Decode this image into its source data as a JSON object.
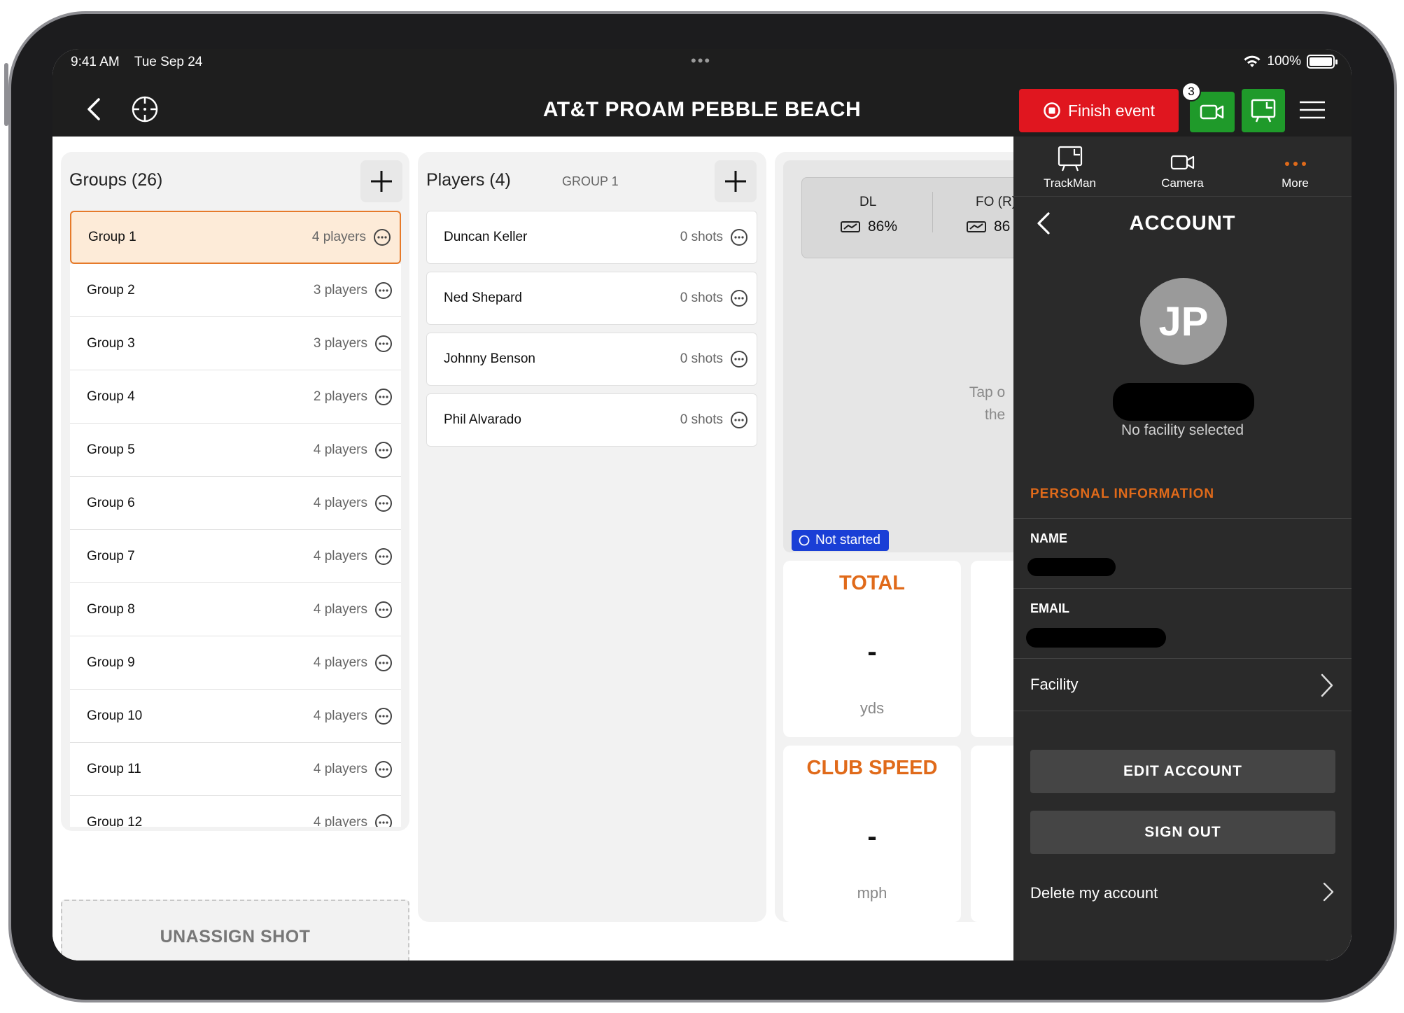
{
  "status": {
    "time": "9:41 AM",
    "date": "Tue Sep 24",
    "battery": "100%"
  },
  "nav": {
    "title": "AT&T PROAM PEBBLE BEACH",
    "finish_label": "Finish event",
    "camera_badge": "3"
  },
  "groups": {
    "title": "Groups (26)",
    "items": [
      {
        "name": "Group 1",
        "count": "4 players"
      },
      {
        "name": "Group 2",
        "count": "3 players"
      },
      {
        "name": "Group 3",
        "count": "3 players"
      },
      {
        "name": "Group 4",
        "count": "2 players"
      },
      {
        "name": "Group 5",
        "count": "4 players"
      },
      {
        "name": "Group 6",
        "count": "4 players"
      },
      {
        "name": "Group 7",
        "count": "4 players"
      },
      {
        "name": "Group 8",
        "count": "4 players"
      },
      {
        "name": "Group 9",
        "count": "4 players"
      },
      {
        "name": "Group 10",
        "count": "4 players"
      },
      {
        "name": "Group 11",
        "count": "4 players"
      },
      {
        "name": "Group 12",
        "count": "4 players"
      }
    ],
    "unassign_label": "UNASSIGN SHOT"
  },
  "players": {
    "title": "Players (4)",
    "group_label": "GROUP 1",
    "items": [
      {
        "name": "Duncan Keller",
        "shots": "0 shots"
      },
      {
        "name": "Ned Shepard",
        "shots": "0 shots"
      },
      {
        "name": "Johnny Benson",
        "shots": "0 shots"
      },
      {
        "name": "Phil Alvarado",
        "shots": "0 shots"
      }
    ]
  },
  "metrics": {
    "dl_label": "DL",
    "dl_value": "86%",
    "fo_label": "FO (R)",
    "fo_value": "86",
    "tap_line1": "Tap o",
    "tap_line2": "the",
    "status_badge": "Not started",
    "total_title": "TOTAL",
    "total_value": "-",
    "total_unit": "yds",
    "club_title": "CLUB SPEED",
    "club_value": "-",
    "club_unit": "mph"
  },
  "account": {
    "tabs": [
      {
        "label": "TrackMan"
      },
      {
        "label": "Camera"
      },
      {
        "label": "More"
      }
    ],
    "title": "ACCOUNT",
    "initials": "JP",
    "no_facility": "No facility selected",
    "section": "PERSONAL INFORMATION",
    "name_label": "NAME",
    "email_label": "EMAIL",
    "facility_label": "Facility",
    "edit_label": "EDIT ACCOUNT",
    "signout_label": "SIGN OUT",
    "delete_label": "Delete my account"
  },
  "colors": {
    "accent": "#e06a1a",
    "danger": "#e0161f",
    "success": "#1f9a2a",
    "status_blue": "#1a3fd6"
  }
}
